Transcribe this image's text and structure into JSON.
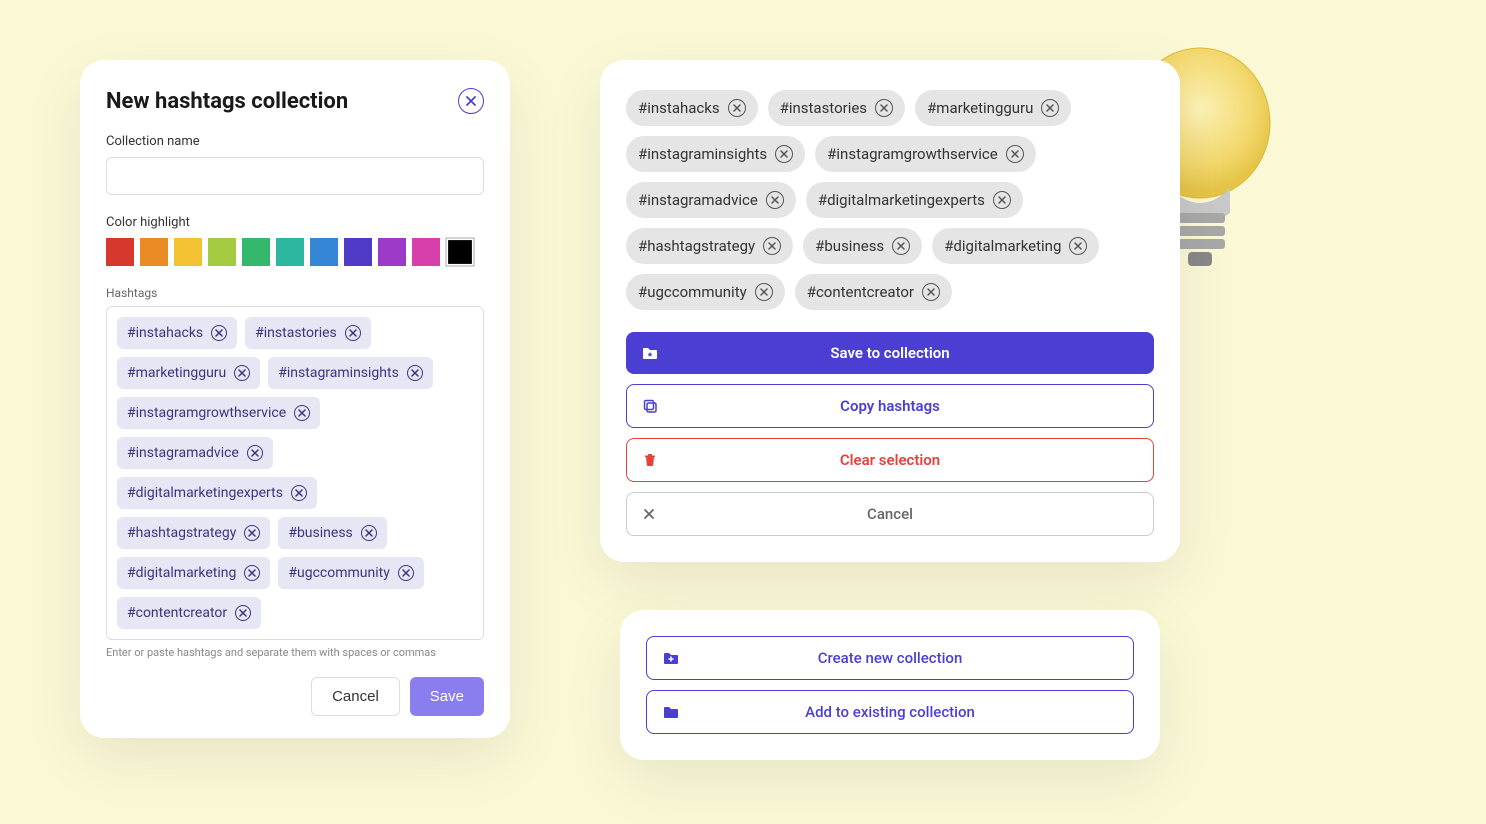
{
  "left": {
    "title": "New hashtags collection",
    "name_label": "Collection name",
    "name_value": "",
    "color_label": "Color highlight",
    "colors": [
      "#D7382D",
      "#E88B24",
      "#F3C333",
      "#A4CB42",
      "#34B86B",
      "#2DB6A0",
      "#3686D6",
      "#4F3BC7",
      "#9B3BC7",
      "#D63FA9"
    ],
    "selected_color": "#000000",
    "hashtags_label": "Hashtags",
    "hashtags": [
      "#instahacks",
      "#instastories",
      "#marketingguru",
      "#instagraminsights",
      "#instagramgrowthservice",
      "#instagramadvice",
      "#digitalmarketingexperts",
      "#hashtagstrategy",
      "#business",
      "#digitalmarketing",
      "#ugccommunity",
      "#contentcreator"
    ],
    "hint": "Enter or paste hashtags and separate them with spaces or commas",
    "cancel_label": "Cancel",
    "save_label": "Save"
  },
  "right": {
    "selected": [
      "#instahacks",
      "#instastories",
      "#marketingguru",
      "#instagraminsights",
      "#instagramgrowthservice",
      "#instagramadvice",
      "#digitalmarketingexperts",
      "#hashtagstrategy",
      "#business",
      "#digitalmarketing",
      "#ugccommunity",
      "#contentcreator"
    ],
    "save_label": "Save to collection",
    "copy_label": "Copy hashtags",
    "clear_label": "Clear selection",
    "cancel_label": "Cancel"
  },
  "bottom": {
    "create_label": "Create new collection",
    "add_label": "Add to existing collection"
  }
}
